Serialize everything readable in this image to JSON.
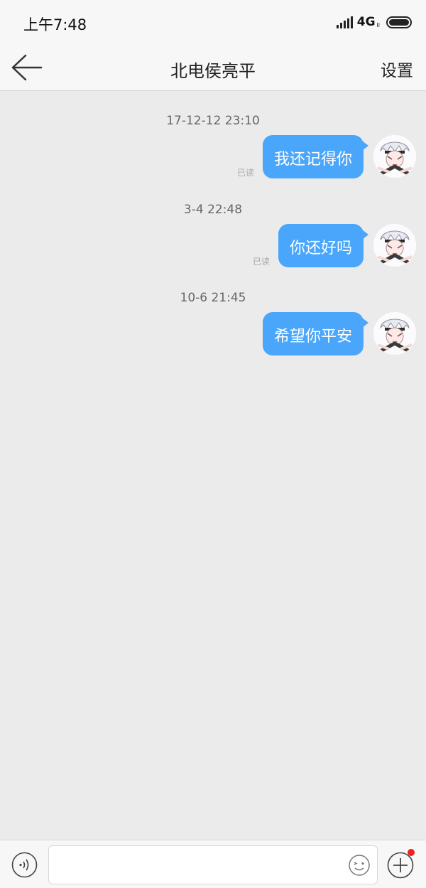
{
  "status_bar": {
    "time": "上午7:48",
    "network": "4G",
    "network_sub": "ll"
  },
  "header": {
    "title": "北电侯亮平",
    "settings_label": "设置"
  },
  "messages": [
    {
      "timestamp": "17-12-12 23:10",
      "text": "我还记得你",
      "status": "已读"
    },
    {
      "timestamp": "3-4 22:48",
      "text": "你还好吗",
      "status": "已读"
    },
    {
      "timestamp": "10-6 21:45",
      "text": "希望你平安",
      "status": ""
    }
  ],
  "input_bar": {
    "value": "",
    "placeholder": ""
  },
  "colors": {
    "bubble": "#4aa6fb",
    "background": "#ebebeb",
    "bar": "#f7f7f7",
    "notification_dot": "#f02020"
  },
  "icons": [
    "back-arrow-icon",
    "voice-icon",
    "emoji-icon",
    "plus-icon",
    "signal-icon",
    "battery-icon"
  ]
}
